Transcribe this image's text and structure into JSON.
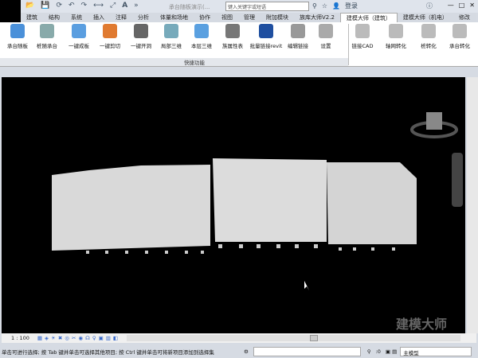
{
  "titlebar": {
    "doc_title": "承台随板演示(...",
    "search_placeholder": "键入关键字或短语",
    "login": "登录"
  },
  "tabs": [
    "建筑",
    "结构",
    "系统",
    "插入",
    "注释",
    "分析",
    "体量和场地",
    "协作",
    "视图",
    "管理",
    "附加模块",
    "族库大师V2.2",
    "建模大师（建筑）",
    "建模大师（机电）",
    "修改"
  ],
  "active_tab": "建模大师（建筑）",
  "ribbon": {
    "buttons": [
      "承台随板",
      "桩随承台",
      "一键成板",
      "一键剪切",
      "一键开洞",
      "局部三维",
      "本层三维",
      "族属性表",
      "批量链接revit",
      "编辑链接",
      "设置"
    ],
    "buttons2": [
      "链接CAD",
      "轴网转化",
      "桩转化",
      "承台转化"
    ],
    "panel_label": "快捷功能"
  },
  "view": {
    "scale": "1 : 100",
    "watermark": "建模大师"
  },
  "status": {
    "hint": "单击可进行选择; 按 Tab 键并单击可选择其他项目; 按 Ctrl 键并单击可将新项目添加到选择集",
    "filter_count": ":0",
    "model": "主模型"
  },
  "colors": {
    "canvas": "#000000",
    "model": "#d9d9d9",
    "accent": "#3a7bd5"
  }
}
